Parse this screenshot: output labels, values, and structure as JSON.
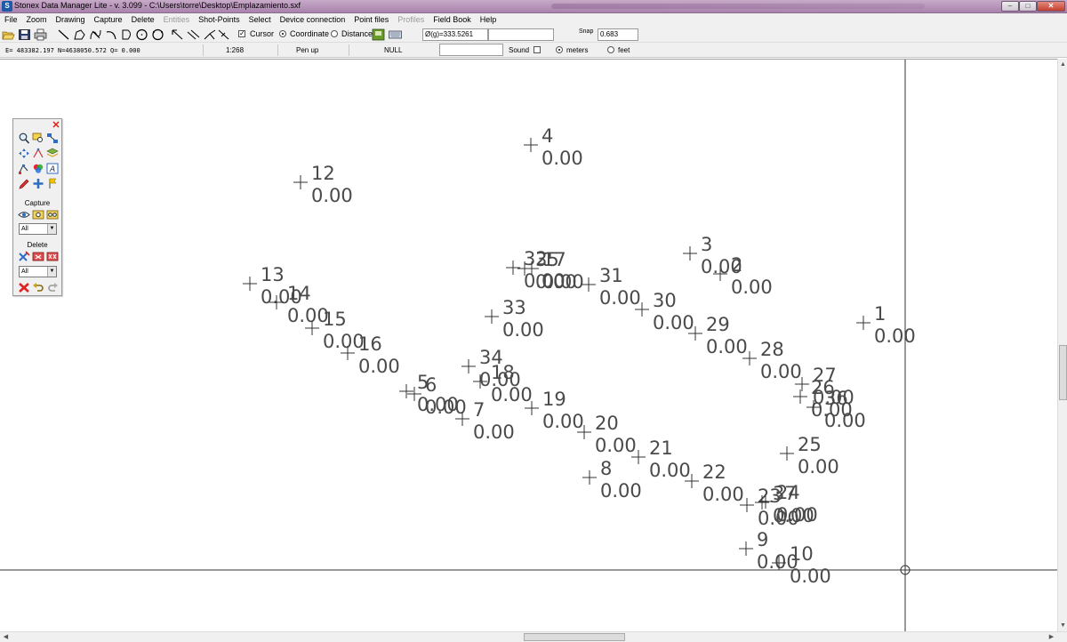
{
  "window": {
    "title": "Stonex Data Manager Lite - v. 3.099 - C:\\Users\\torre\\Desktop\\Emplazamiento.sxf",
    "controls": {
      "minimize": "–",
      "maximize": "□",
      "close": "✕"
    }
  },
  "menu": [
    {
      "label": "File",
      "enabled": true
    },
    {
      "label": "Zoom",
      "enabled": true
    },
    {
      "label": "Drawing",
      "enabled": true
    },
    {
      "label": "Capture",
      "enabled": true
    },
    {
      "label": "Delete",
      "enabled": true
    },
    {
      "label": "Entities",
      "enabled": false
    },
    {
      "label": "Shot-Points",
      "enabled": true
    },
    {
      "label": "Select",
      "enabled": true
    },
    {
      "label": "Device connection",
      "enabled": true
    },
    {
      "label": "Point files",
      "enabled": true
    },
    {
      "label": "Profiles",
      "enabled": false
    },
    {
      "label": "Field Book",
      "enabled": true
    },
    {
      "label": "Help",
      "enabled": true
    }
  ],
  "toolbar": {
    "cursor_label": "Cursor",
    "cursor_checked": true,
    "coordinate_label": "Coordinate",
    "distance_label": "Distance",
    "selected_mode": "Coordinate",
    "angle_readout": "Ø(g)=333.5261",
    "blank_field": "",
    "snap_label": "Snap",
    "snap_value": "0.683"
  },
  "statusbar": {
    "coordinates": "E=  483382.197  N=4638050.572  Q=     0.000",
    "scale": "1:268",
    "pen": "Pen up",
    "entity": "NULL",
    "input_value": "",
    "sound_label": "Sound",
    "sound_checked": false,
    "meters_label": "meters",
    "feet_label": "feet",
    "unit_selected": "meters"
  },
  "palette": {
    "close": "✕",
    "capture_label": "Capture",
    "capture_filter": "All",
    "delete_label": "Delete",
    "delete_filter": "All"
  },
  "scrollbars": {
    "up": "▲",
    "down": "▼",
    "left": "◀",
    "right": "▶"
  },
  "drawing": {
    "crosshair": {
      "easting_m": 483382.197,
      "northing_m": 4638050.572
    },
    "points": [
      {
        "id": "1",
        "elevation": "0.00"
      },
      {
        "id": "2",
        "elevation": "0.00"
      },
      {
        "id": "3",
        "elevation": "0.00"
      },
      {
        "id": "4",
        "elevation": "0.00"
      },
      {
        "id": "5",
        "elevation": "0.00"
      },
      {
        "id": "6",
        "elevation": "0.00"
      },
      {
        "id": "7",
        "elevation": "0.00"
      },
      {
        "id": "8",
        "elevation": "0.00"
      },
      {
        "id": "9",
        "elevation": "0.00"
      },
      {
        "id": "10",
        "elevation": "0.00"
      },
      {
        "id": "12",
        "elevation": "0.00"
      },
      {
        "id": "13",
        "elevation": "0.00"
      },
      {
        "id": "14",
        "elevation": "0.00"
      },
      {
        "id": "15",
        "elevation": "0.00"
      },
      {
        "id": "16",
        "elevation": "0.00"
      },
      {
        "id": "17",
        "elevation": "0.00"
      },
      {
        "id": "18",
        "elevation": "0.00"
      },
      {
        "id": "19",
        "elevation": "0.00"
      },
      {
        "id": "20",
        "elevation": "0.00"
      },
      {
        "id": "21",
        "elevation": "0.00"
      },
      {
        "id": "22",
        "elevation": "0.00"
      },
      {
        "id": "23",
        "elevation": "0.00"
      },
      {
        "id": "24",
        "elevation": "0.00"
      },
      {
        "id": "25",
        "elevation": "0.00"
      },
      {
        "id": "26",
        "elevation": "0.00"
      },
      {
        "id": "27",
        "elevation": "0.00"
      },
      {
        "id": "28",
        "elevation": "0.00"
      },
      {
        "id": "29",
        "elevation": "0.00"
      },
      {
        "id": "30",
        "elevation": "0.00"
      },
      {
        "id": "31",
        "elevation": "0.00"
      },
      {
        "id": "32",
        "elevation": "0.00"
      },
      {
        "id": "33",
        "elevation": "0.00"
      },
      {
        "id": "34",
        "elevation": "0.00"
      },
      {
        "id": "35",
        "elevation": "0.00"
      },
      {
        "id": "36",
        "elevation": "0.00"
      },
      {
        "id": "37",
        "elevation": "0.00"
      }
    ]
  }
}
